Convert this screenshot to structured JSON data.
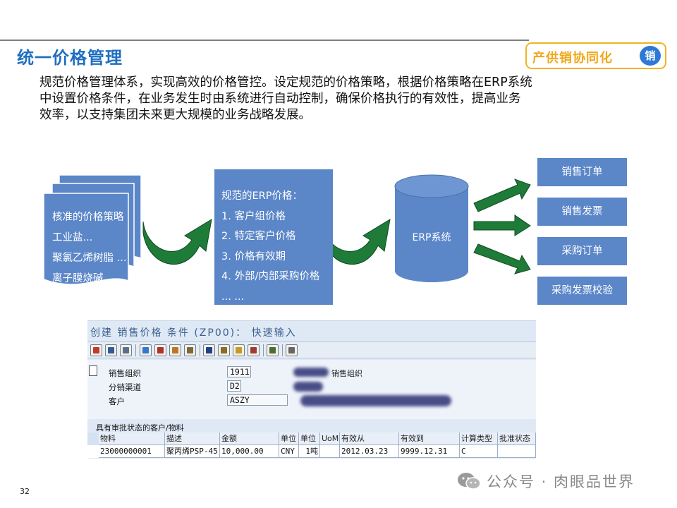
{
  "slide": {
    "title": "统一价格管理",
    "badge_text": "产供销协同化",
    "badge_icon_char": "销",
    "intro_lines": [
      "规范价格管理体系，实现高效的价格管控。设定规范的价格策略，根据价格策略在ERP系统",
      "中设置价格条件，在业务发生时由系统进行自动控制，确保价格执行的有效性，提高业务",
      "效率，以支持集团未来更大规模的业务战略发展。"
    ],
    "page_number": "32",
    "watermark": "公众号 · 肉眼品世界"
  },
  "diagram": {
    "doc_lines": [
      "核准的价格策略",
      "工业盐...",
      "聚氯乙烯树脂 ...",
      "离子膜烧碱..."
    ],
    "erp_lines": [
      "规范的ERP价格：",
      "1. 客户组价格",
      "2. 特定客户价格",
      "3. 价格有效期",
      "4. 外部/内部采购价格",
      "... ..."
    ],
    "cylinder_label": "ERP系统",
    "outputs": [
      "销售订单",
      "销售发票",
      "采购订单",
      "采购发票校验"
    ],
    "colors": {
      "box": "#5b86c8",
      "arrow_green": "#1e7b38",
      "title_blue": "#1f6fc0",
      "badge_orange": "#f0a81a"
    }
  },
  "sap": {
    "window_title": "创建 销售价格 条件 (ZP00)： 快速输入",
    "toolbar_icons": [
      "display-icon",
      "table-icon",
      "list-icon",
      "detail-icon",
      "copy-icon",
      "package-icon",
      "edit-icon",
      "info-icon",
      "tree-icon",
      "key-icon",
      "scissors-icon",
      "person-icon",
      "layout-icon"
    ],
    "fields": [
      {
        "label": "销售组织",
        "value": "1911",
        "desc": "销售组织"
      },
      {
        "label": "分销渠道",
        "value": "D2",
        "desc": ""
      },
      {
        "label": "客户",
        "value": "ASZY",
        "desc": ""
      }
    ],
    "grid_title": "具有审批状态的客户/物料",
    "grid_headers": [
      "物料",
      "描述",
      "金额",
      "单位",
      "单位",
      "UoM",
      "有效从",
      "有效到",
      "计算类型",
      "批准状态"
    ],
    "grid_row": [
      "23000000001",
      "聚丙烯PSP-45",
      "10,000.00",
      "CNY",
      "1吨",
      "",
      "2012.03.23",
      "9999.12.31",
      "C",
      ""
    ]
  }
}
